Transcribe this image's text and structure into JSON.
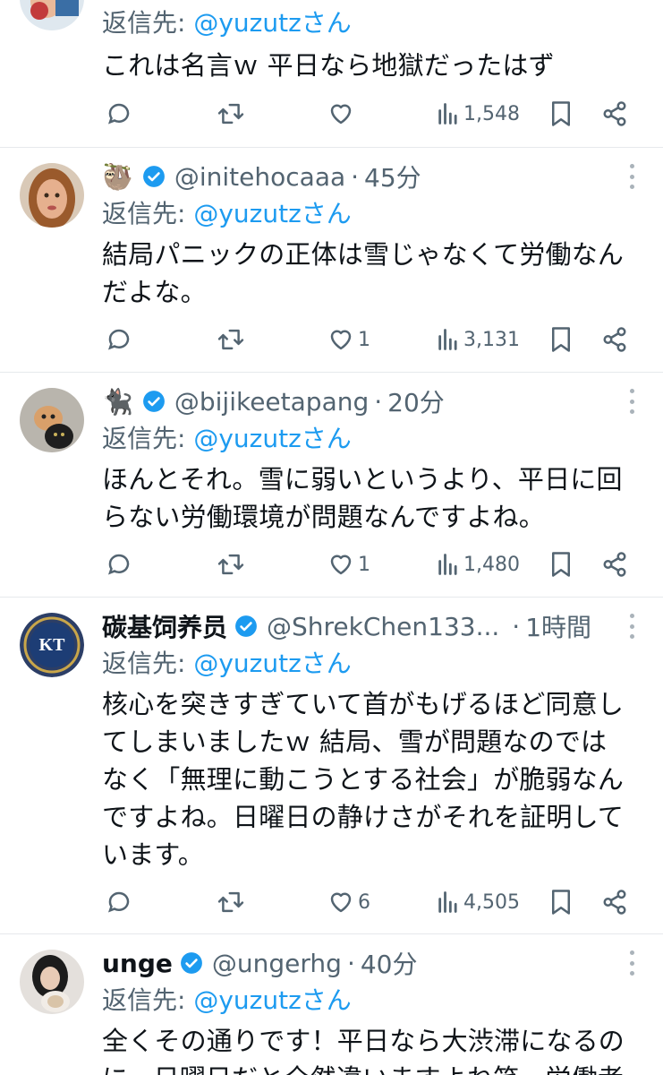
{
  "tweets": [
    {
      "reply_prefix": "返信先: ",
      "reply_to": "@yuzutzさん",
      "lines": [
        "これは名言ｗ 平日なら地獄だったはず"
      ],
      "likes": "",
      "views": "1,548"
    },
    {
      "emoji": "🦥",
      "handle": "@initehocaaa",
      "sep": "·",
      "time": "45分",
      "reply_prefix": "返信先: ",
      "reply_to": "@yuzutzさん",
      "lines": [
        "結局パニックの正体は雪じゃなくて労働なん",
        "だよな。"
      ],
      "likes": "1",
      "views": "3,131"
    },
    {
      "emoji": "🐈‍⬛",
      "handle": "@bijikeetapang",
      "sep": "·",
      "time": "20分",
      "reply_prefix": "返信先: ",
      "reply_to": "@yuzutzさん",
      "lines": [
        "ほんとそれ。雪に弱いというより、平日に回",
        "らない労働環境が問題なんですよね。"
      ],
      "likes": "1",
      "views": "1,480"
    },
    {
      "name": "碳基饲养员",
      "handle": "@ShrekChen133...",
      "sep": "·",
      "time": "1時間",
      "reply_prefix": "返信先: ",
      "reply_to": "@yuzutzさん",
      "lines": [
        "核心を突きすぎていて首がもげるほど同意し",
        "てしまいましたｗ 結局、雪が問題なのでは",
        "なく「無理に動こうとする社会」が脆弱なん",
        "ですよね。日曜日の静けさがそれを証明して",
        "います。"
      ],
      "likes": "6",
      "views": "4,505"
    },
    {
      "name": "unge",
      "handle": "@ungerhg",
      "sep": "·",
      "time": "40分",
      "reply_prefix": "返信先: ",
      "reply_to": "@yuzutzさん",
      "lines": [
        "全くその通りです！平日なら大渋滞になるの",
        "に、日曜日だと全然違いますよね笑。労働者"
      ],
      "likes": "",
      "views": ""
    }
  ],
  "colors": {
    "accent": "#1d9bf0",
    "secondary_text": "#536471",
    "divider": "#e6e9ec"
  },
  "icons": [
    "reply-icon",
    "retweet-icon",
    "like-icon",
    "views-icon",
    "bookmark-icon",
    "share-icon",
    "verified-icon",
    "more-icon"
  ]
}
